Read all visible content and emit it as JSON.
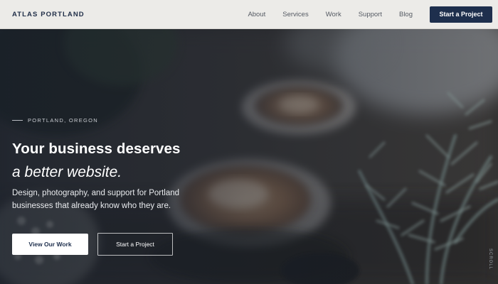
{
  "header": {
    "logo": "ATLAS PORTLAND",
    "nav": [
      "About",
      "Services",
      "Work",
      "Support",
      "Blog"
    ],
    "cta_label": "Start a Project"
  },
  "hero": {
    "eyebrow": "PORTLAND, OREGON",
    "headline_line1": "Your business deserves",
    "headline_line2": "a better website.",
    "subtext": "Design, photography, and support for Portland businesses that already know who they are.",
    "primary_button": "View Our Work",
    "secondary_button": "Start a Project",
    "scroll_label": "SCROLL",
    "background_image": "blurred-coffee-latte-with-plants"
  },
  "colors": {
    "brand_navy": "#1e2f4d",
    "header_bg": "#ecebe8",
    "hero_text": "#ffffff"
  }
}
